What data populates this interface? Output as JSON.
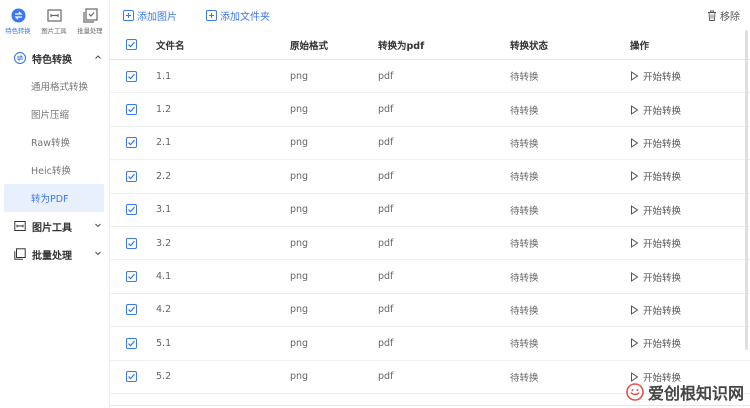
{
  "top_tabs": [
    {
      "label": "特色转换",
      "icon": "convert-icon",
      "active": true
    },
    {
      "label": "图片工具",
      "icon": "image-tool-icon",
      "active": false
    },
    {
      "label": "批量处理",
      "icon": "batch-icon",
      "active": false
    }
  ],
  "sidebar": {
    "groups": [
      {
        "label": "特色转换",
        "icon": "convert-icon",
        "expanded": true,
        "items": [
          "通用格式转换",
          "图片压缩",
          "Raw转换",
          "Heic转换",
          "转为PDF"
        ],
        "active_item": "转为PDF"
      },
      {
        "label": "图片工具",
        "icon": "image-tool-icon",
        "expanded": false
      },
      {
        "label": "批量处理",
        "icon": "batch-icon",
        "expanded": false
      }
    ]
  },
  "toolbar": {
    "add_image": "添加图片",
    "add_folder": "添加文件夹",
    "remove": "移除"
  },
  "table": {
    "headers": {
      "name": "文件名",
      "format": "原始格式",
      "to": "转换为pdf",
      "status": "转换状态",
      "op": "操作"
    },
    "rows": [
      {
        "name": "1.1",
        "format": "png",
        "to": "pdf",
        "status": "待转换",
        "op": "开始转换",
        "checked": true
      },
      {
        "name": "1.2",
        "format": "png",
        "to": "pdf",
        "status": "待转换",
        "op": "开始转换",
        "checked": true
      },
      {
        "name": "2.1",
        "format": "png",
        "to": "pdf",
        "status": "待转换",
        "op": "开始转换",
        "checked": true
      },
      {
        "name": "2.2",
        "format": "png",
        "to": "pdf",
        "status": "待转换",
        "op": "开始转换",
        "checked": true
      },
      {
        "name": "3.1",
        "format": "png",
        "to": "pdf",
        "status": "待转换",
        "op": "开始转换",
        "checked": true
      },
      {
        "name": "3.2",
        "format": "png",
        "to": "pdf",
        "status": "待转换",
        "op": "开始转换",
        "checked": true
      },
      {
        "name": "4.1",
        "format": "png",
        "to": "pdf",
        "status": "待转换",
        "op": "开始转换",
        "checked": true
      },
      {
        "name": "4.2",
        "format": "png",
        "to": "pdf",
        "status": "待转换",
        "op": "开始转换",
        "checked": true
      },
      {
        "name": "5.1",
        "format": "png",
        "to": "pdf",
        "status": "待转换",
        "op": "开始转换",
        "checked": true
      },
      {
        "name": "5.2",
        "format": "png",
        "to": "pdf",
        "status": "待转换",
        "op": "开始转换",
        "checked": true
      }
    ]
  },
  "watermark": "爱创根知识网",
  "colors": {
    "accent": "#3a78f2",
    "active_bg": "#e9f0fd"
  }
}
